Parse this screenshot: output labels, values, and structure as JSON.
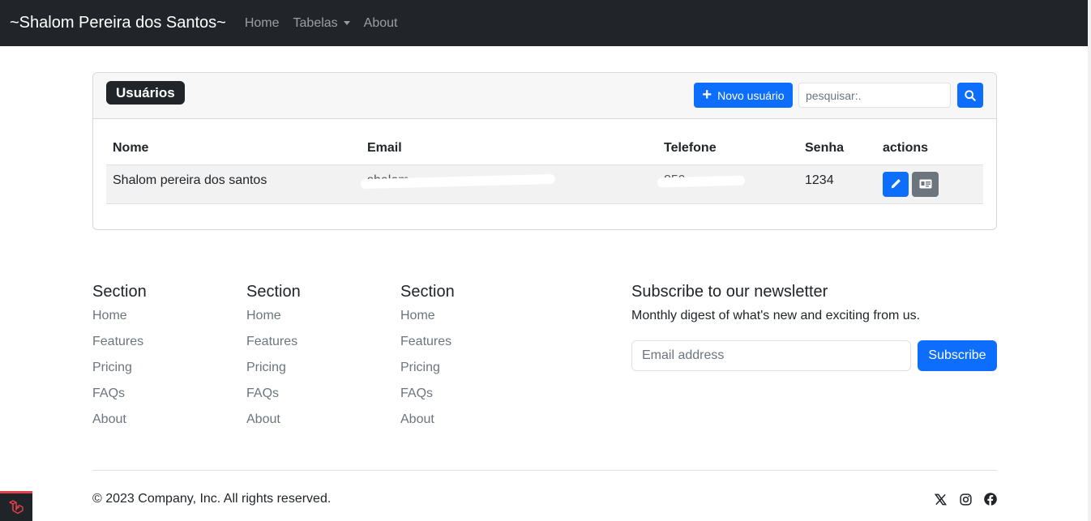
{
  "navbar": {
    "brand": "~Shalom Pereira dos Santos~",
    "links": [
      "Home",
      "Tabelas",
      "About"
    ]
  },
  "card": {
    "title": "Usuários",
    "new_button_label": "Novo usuário",
    "search_placeholder": "pesquisar:."
  },
  "table": {
    "headers": [
      "Nome",
      "Email",
      "Telefone",
      "Senha",
      "actions"
    ],
    "rows": [
      {
        "nome": "Shalom pereira dos santos",
        "email": "shalom...",
        "telefone": "859...",
        "senha": "1234"
      }
    ]
  },
  "footer": {
    "columns": [
      {
        "title": "Section",
        "links": [
          "Home",
          "Features",
          "Pricing",
          "FAQs",
          "About"
        ]
      },
      {
        "title": "Section",
        "links": [
          "Home",
          "Features",
          "Pricing",
          "FAQs",
          "About"
        ]
      },
      {
        "title": "Section",
        "links": [
          "Home",
          "Features",
          "Pricing",
          "FAQs",
          "About"
        ]
      }
    ],
    "newsletter": {
      "title": "Subscribe to our newsletter",
      "description": "Monthly digest of what's new and exciting from us.",
      "email_placeholder": "Email address",
      "subscribe_label": "Subscribe"
    },
    "copyright": "© 2023 Company, Inc. All rights reserved."
  },
  "icons": {
    "accent": "#0d6efd",
    "dark": "#212529",
    "social": [
      "x-icon",
      "instagram-icon",
      "facebook-icon"
    ]
  }
}
